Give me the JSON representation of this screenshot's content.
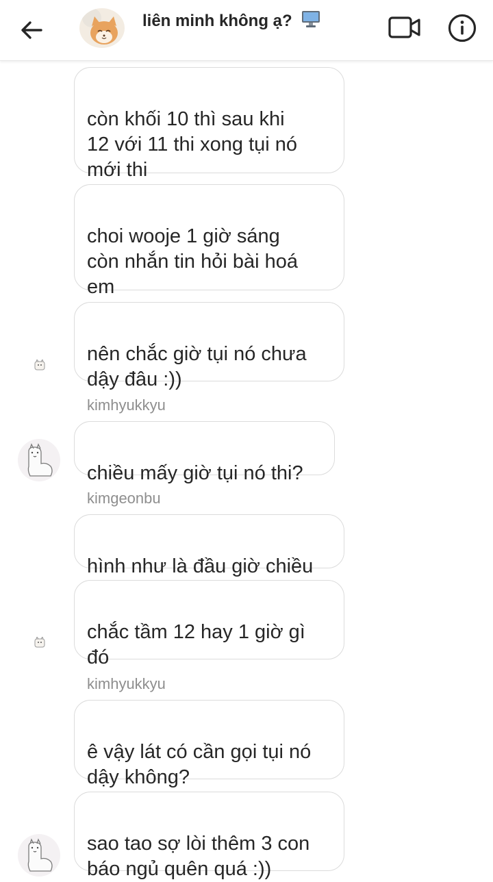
{
  "header": {
    "title": "liên minh không ạ?",
    "title_emoji_icon": "desktop-computer-icon",
    "back_icon": "arrow-left-icon",
    "video_icon": "video-camera-icon",
    "info_icon": "info-icon"
  },
  "messages": [
    {
      "text": "còn khối 10 thì sau khi\n12 với 11 thi xong tụi nó\nmới thi"
    },
    {
      "text": "choi wooje 1 giờ sáng\ncòn nhắn tin hỏi bài hoá\nem"
    },
    {
      "text": "nên chắc giờ tụi nó chưa\ndậy đâu :))"
    },
    {
      "sender": "kimhyukkyu",
      "text": "chiều mấy giờ tụi nó thi?"
    },
    {
      "sender": "kimgeonbu",
      "text": "hình như là đầu giờ chiều"
    },
    {
      "text": "chắc tầm 12 hay 1 giờ gì\nđó"
    },
    {
      "sender": "kimhyukkyu",
      "text": "ê vậy lát có cần gọi tụi nó\ndậy không?"
    },
    {
      "text": "sao tao sợ lòi thêm 3 con\nbáo ngủ quên quá :))"
    }
  ]
}
